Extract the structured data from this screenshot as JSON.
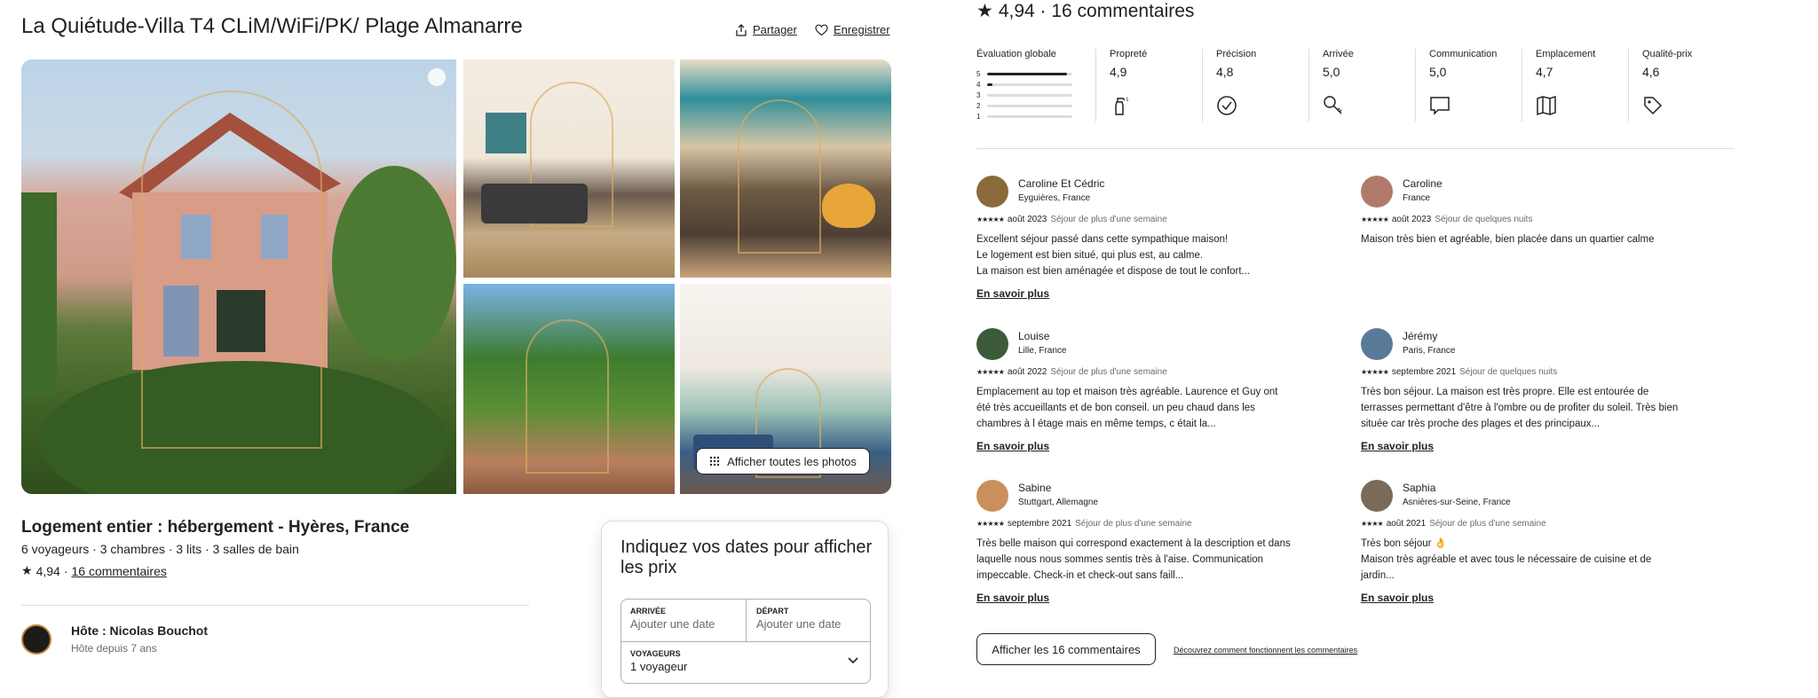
{
  "listing": {
    "title": "La Quiétude-Villa T4 CLiM/WiFi/PK/ Plage Almanarre",
    "share_label": "Partager",
    "save_label": "Enregistrer",
    "show_all_photos": "Afficher toutes les photos",
    "subtitle": "Logement entier : hébergement - Hyères, France",
    "meta": "6 voyageurs · 3 chambres · 3 lits · 3 salles de bain",
    "rating": "4,94",
    "rating_sep": "·",
    "reviews_link": "16 commentaires"
  },
  "host": {
    "name": "Hôte : Nicolas Bouchot",
    "since": "Hôte depuis 7 ans"
  },
  "booking": {
    "prompt": "Indiquez vos dates pour afficher les prix",
    "arrival_label": "ARRIVÉE",
    "arrival_placeholder": "Ajouter une date",
    "departure_label": "DÉPART",
    "departure_placeholder": "Ajouter une date",
    "guests_label": "VOYAGEURS",
    "guests_value": "1 voyageur"
  },
  "ratings": {
    "header": "4,94 · 16 commentaires",
    "overall_label": "Évaluation globale",
    "distribution": [
      {
        "star": "5",
        "fraction": 0.94
      },
      {
        "star": "4",
        "fraction": 0.06
      },
      {
        "star": "3",
        "fraction": 0
      },
      {
        "star": "2",
        "fraction": 0
      },
      {
        "star": "1",
        "fraction": 0
      }
    ],
    "categories": [
      {
        "label": "Propreté",
        "value": "4,9",
        "icon": "spray-bottle-icon"
      },
      {
        "label": "Précision",
        "value": "4,8",
        "icon": "check-circle-icon"
      },
      {
        "label": "Arrivée",
        "value": "5,0",
        "icon": "key-icon"
      },
      {
        "label": "Communication",
        "value": "5,0",
        "icon": "chat-bubble-icon"
      },
      {
        "label": "Emplacement",
        "value": "4,7",
        "icon": "map-icon"
      },
      {
        "label": "Qualité-prix",
        "value": "4,6",
        "icon": "price-tag-icon"
      }
    ]
  },
  "reviews": [
    {
      "name": "Caroline Et Cédric",
      "location": "Eyguières, France",
      "stars": "★★★★★",
      "date": "août 2023",
      "stay": "Séjour de plus d'une semaine",
      "text": "Excellent séjour passé dans cette sympathique maison!\nLe logement est bien situé, qui plus est, au calme.\nLa maison est bien aménagée et dispose de tout le confort...",
      "more": "En savoir plus",
      "avatar_color": "#8a6a3a"
    },
    {
      "name": "Caroline",
      "location": "France",
      "stars": "★★★★★",
      "date": "août 2023",
      "stay": "Séjour de quelques nuits",
      "text": "Maison très bien et agréable, bien placée dans un quartier calme",
      "more": "",
      "avatar_color": "#b07a6a"
    },
    {
      "name": "Louise",
      "location": "Lille, France",
      "stars": "★★★★★",
      "date": "août 2022",
      "stay": "Séjour de plus d'une semaine",
      "text": "Emplacement au top et maison très agréable. Laurence et Guy ont été très accueillants et de bon conseil. un peu chaud dans les chambres à l étage mais en même temps, c était la...",
      "more": "En savoir plus",
      "avatar_color": "#3d5a3a"
    },
    {
      "name": "Jérémy",
      "location": "Paris, France",
      "stars": "★★★★★",
      "date": "septembre 2021",
      "stay": "Séjour de quelques nuits",
      "text": "Très bon séjour. La maison est très propre. Elle est entourée de terrasses permettant d'être à l'ombre ou de profiter du soleil. Très bien située car très proche des plages et des principaux...",
      "more": "En savoir plus",
      "avatar_color": "#5a7a9a"
    },
    {
      "name": "Sabine",
      "location": "Stuttgart, Allemagne",
      "stars": "★★★★★",
      "date": "septembre 2021",
      "stay": "Séjour de plus d'une semaine",
      "text": "Très belle maison qui correspond exactement à la description et dans laquelle nous nous sommes sentis très à l'aise. Communication impeccable. Check-in et check-out sans faill...",
      "more": "En savoir plus",
      "avatar_color": "#c9905e"
    },
    {
      "name": "Saphia",
      "location": "Asnières-sur-Seine, France",
      "stars": "★★★★",
      "date": "août 2021",
      "stay": "Séjour de plus d'une semaine",
      "text": "Très bon séjour 👌\nMaison très agréable et avec tous le nécessaire de cuisine et de jardin...",
      "more": "En savoir plus",
      "avatar_color": "#7a6a5a"
    }
  ],
  "footer": {
    "show_all_reviews": "Afficher les 16 commentaires",
    "learn_link": "Découvrez comment fonctionnent les commentaires"
  }
}
